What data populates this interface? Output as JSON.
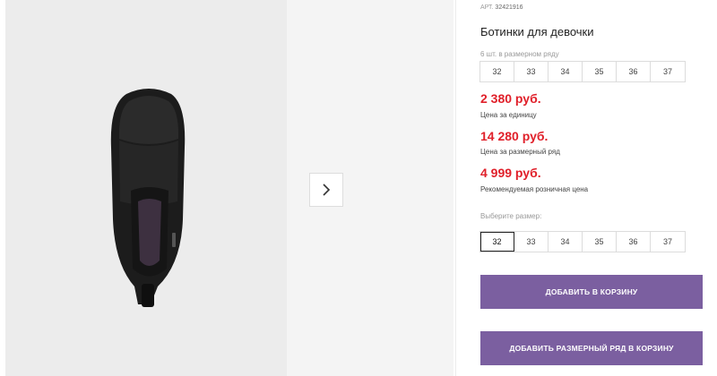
{
  "gallery": {
    "next_icon": "chevron-right-icon"
  },
  "product": {
    "article_label": "АРТ.",
    "article_value": "32421916",
    "title": "Ботинки для девочки"
  },
  "size_row": {
    "hint": "6 шт. в размерном ряду",
    "sizes": [
      "32",
      "33",
      "34",
      "35",
      "36",
      "37"
    ]
  },
  "prices": {
    "unit_price": "2 380 руб.",
    "unit_label": "Цена за единицу",
    "row_price": "14 280 руб.",
    "row_label": "Цена за размерный ряд",
    "retail_price": "4 999 руб.",
    "retail_label": "Рекомендуемая розничная цена"
  },
  "size_select": {
    "hint": "Выберите размер:",
    "sizes": [
      "32",
      "33",
      "34",
      "35",
      "36",
      "37"
    ],
    "selected": "32"
  },
  "buttons": {
    "add_to_cart": "ДОБАВИТЬ В КОРЗИНУ",
    "add_row_to_cart": "ДОБАВИТЬ РАЗМЕРНЫЙ РЯД В КОРЗИНУ"
  },
  "colors": {
    "price": "#e0202a",
    "button": "#7b5fa0"
  }
}
